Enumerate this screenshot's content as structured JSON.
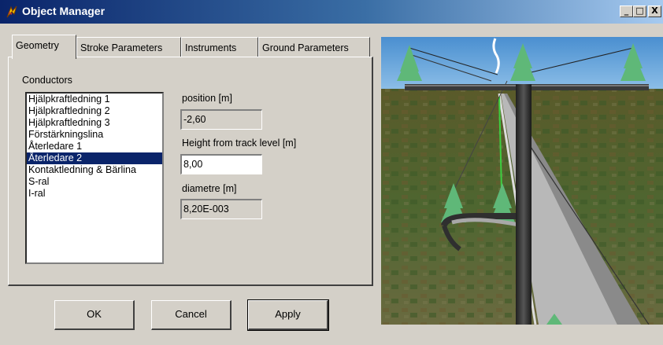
{
  "window": {
    "title": "Object Manager",
    "controls": [
      "_",
      "□",
      "X"
    ]
  },
  "tabs": [
    {
      "label": "Geometry",
      "active": true
    },
    {
      "label": "Stroke Parameters",
      "active": false
    },
    {
      "label": "Instruments",
      "active": false
    },
    {
      "label": "Ground Parameters",
      "active": false
    }
  ],
  "geometry": {
    "conductors_label": "Conductors",
    "conductors": [
      "Hjälpkraftledning 1",
      "Hjälpkraftledning 2",
      "Hjälpkraftledning 3",
      "Förstärkningslina",
      "Återledare 1",
      "Återledare 2",
      "Kontaktledning & Bärlina",
      "S-ral",
      "I-ral"
    ],
    "selected_conductor": "Återledare 2",
    "position_label": "position [m]",
    "position_value": "-2,60",
    "height_label": "Height from track level  [m]",
    "height_value": "8,00",
    "diametre_label": "diametre  [m]",
    "diametre_value": "8,20E-003"
  },
  "buttons": {
    "ok": "OK",
    "cancel": "Cancel",
    "apply": "Apply"
  },
  "colors": {
    "titlebar_start": "#0a246a",
    "titlebar_end": "#a6caf0",
    "selection": "#0a246a",
    "dialog_bg": "#d4d0c8",
    "sky": "#5b9bd0",
    "ground": "#4a5a28",
    "tree": "#5fb878"
  }
}
